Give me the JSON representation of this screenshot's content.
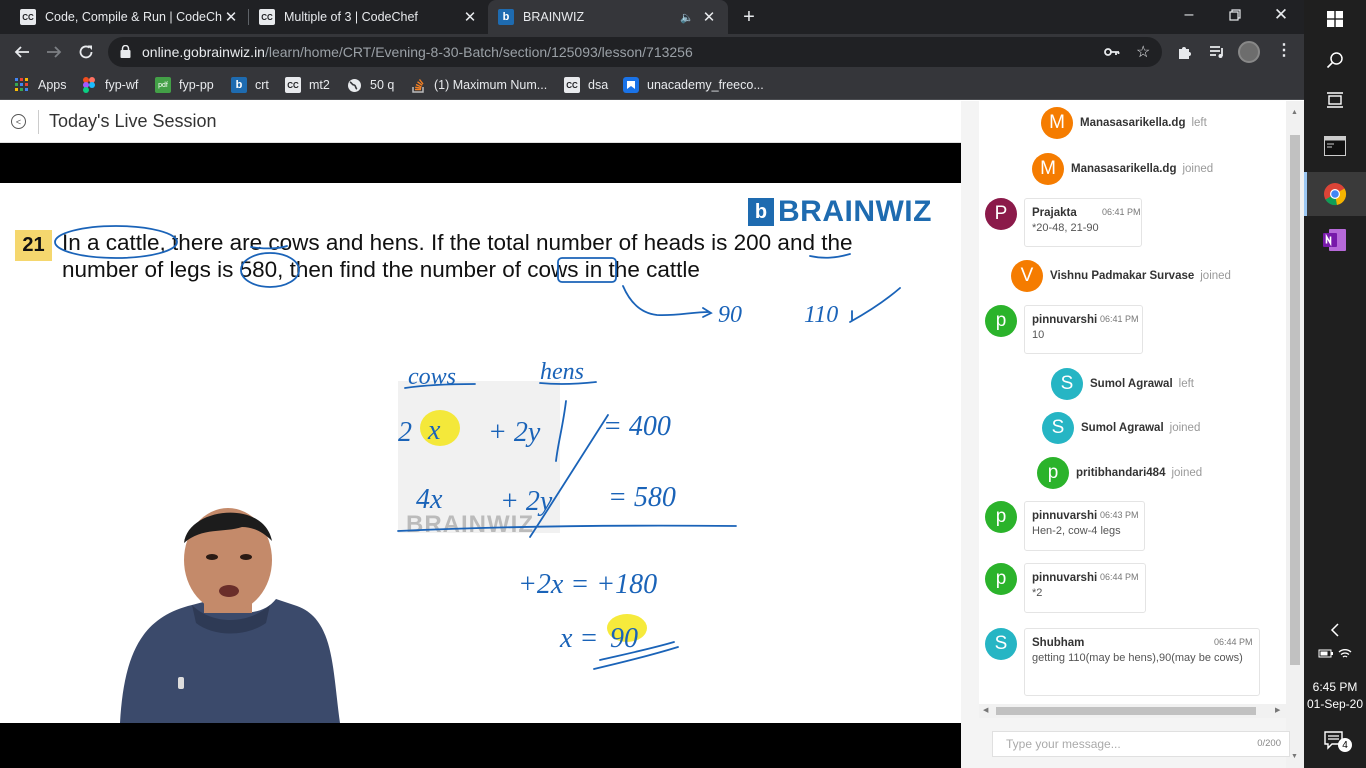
{
  "browser": {
    "tabs": [
      {
        "title": "Code, Compile & Run | CodeChef",
        "icon": "codechef-icon"
      },
      {
        "title": "Multiple of 3 | CodeChef",
        "icon": "codechef-icon"
      },
      {
        "title": "BRAINWIZ",
        "icon": "brainwiz-icon",
        "active": true,
        "audio": true
      }
    ],
    "url_host": "online.gobrainwiz.in",
    "url_path": "/learn/home/CRT/Evening-8-30-Batch/section/125093/lesson/713256",
    "bookmarks": [
      {
        "label": "Apps",
        "icon": "apps-grid-icon"
      },
      {
        "label": "fyp-wf",
        "icon": "figma-icon"
      },
      {
        "label": "fyp-pp",
        "icon": "pdf-icon"
      },
      {
        "label": "crt",
        "icon": "brainwiz-icon"
      },
      {
        "label": "mt2",
        "icon": "codechef-icon"
      },
      {
        "label": "50 q",
        "icon": "globe-icon"
      },
      {
        "label": "(1) Maximum Num...",
        "icon": "stackoverflow-icon"
      },
      {
        "label": "dsa",
        "icon": "codechef-icon"
      },
      {
        "label": "unacademy_freeco...",
        "icon": "bookmark-icon"
      }
    ]
  },
  "session": {
    "title": "Today's Live Session"
  },
  "slide": {
    "logo": "BRAINWIZ",
    "logo_mark": "b",
    "question_number": "21",
    "question_line1": "In a cattle, there are cows and hens. If the total number of heads is 200 and the",
    "question_line2": "number of legs is 580, then find the number of cows in the cattle",
    "watermark": "BRAINWIZ",
    "handwriting": {
      "answer_a": "90",
      "answer_b": "110",
      "label_cows": "cows",
      "label_hens": "hens",
      "eq1_left": "2",
      "eq1_x": "x",
      "eq1_mid": "+ 2y",
      "eq1_right": "= 400",
      "eq2_left": "4x",
      "eq2_mid": "+ 2y",
      "eq2_right": "= 580",
      "eq3": "+2x = +180",
      "eq4_left": "x =",
      "eq4_result": "90"
    }
  },
  "chat": {
    "messages": [
      {
        "type": "system",
        "initial": "M",
        "name": "Manasasarikella.dg",
        "action": "left",
        "color": "#f57c00"
      },
      {
        "type": "system",
        "initial": "M",
        "name": "Manasasarikella.dg",
        "action": "joined",
        "color": "#f57c00"
      },
      {
        "type": "message",
        "initial": "P",
        "name": "Prajakta",
        "time": "06:41 PM",
        "text": "*20-48, 21-90",
        "color": "#8b1a4a"
      },
      {
        "type": "system",
        "initial": "V",
        "name": "Vishnu Padmakar Survase",
        "action": "joined",
        "color": "#f57c00"
      },
      {
        "type": "message",
        "initial": "p",
        "name": "pinnuvarshi",
        "time": "06:41 PM",
        "text": "10",
        "color": "#2bb32b"
      },
      {
        "type": "system",
        "initial": "S",
        "name": "Sumol Agrawal",
        "action": "left",
        "color": "#26b5c4"
      },
      {
        "type": "system",
        "initial": "S",
        "name": "Sumol Agrawal",
        "action": "joined",
        "color": "#26b5c4"
      },
      {
        "type": "system",
        "initial": "p",
        "name": "pritibhandari484",
        "action": "joined",
        "color": "#2bb32b"
      },
      {
        "type": "message",
        "initial": "p",
        "name": "pinnuvarshi",
        "time": "06:43 PM",
        "text": "Hen-2, cow-4 legs",
        "color": "#2bb32b"
      },
      {
        "type": "message",
        "initial": "p",
        "name": "pinnuvarshi",
        "time": "06:44 PM",
        "text": "*2",
        "color": "#2bb32b"
      },
      {
        "type": "message",
        "initial": "S",
        "name": "Shubham",
        "time": "06:44 PM",
        "text": "getting 110(may be hens),90(may be cows)",
        "color": "#26b5c4"
      }
    ],
    "input_placeholder": "Type your message...",
    "char_count": "0/200"
  },
  "taskbar": {
    "time": "6:45 PM",
    "date": "01-Sep-20",
    "notification_count": "4"
  }
}
